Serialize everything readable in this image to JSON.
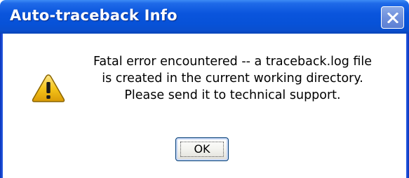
{
  "dialog": {
    "title": "Auto-traceback Info",
    "message_lines": [
      "Fatal error encountered -- a traceback.log file",
      "is created in the current working directory.",
      "Please send it to technical support."
    ],
    "ok_label": "OK",
    "icons": {
      "warning": "warning-icon",
      "close": "close-icon"
    },
    "colors": {
      "titlebar": "#0752d8",
      "warning_yellow": "#f6c51a"
    }
  }
}
